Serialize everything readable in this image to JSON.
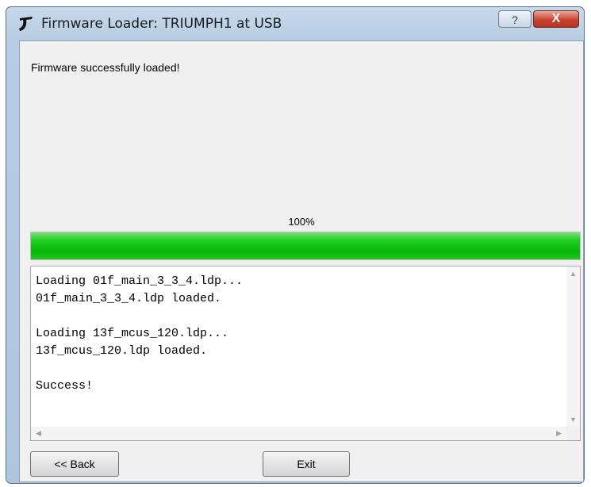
{
  "window": {
    "title": "Firmware Loader:  TRIUMPH1 at USB",
    "help_label": "?",
    "close_label": "X",
    "app_icon": "javad-logo-icon"
  },
  "status": {
    "message": "Firmware successfully loaded!"
  },
  "progress": {
    "percent_label": "100%",
    "value": 1.0,
    "color": "#0dc10d"
  },
  "log": {
    "text": "Loading 01f_main_3_3_4.ldp...\n01f_main_3_3_4.ldp loaded.\n\nLoading 13f_mcus_120.ldp...\n13f_mcus_120.ldp loaded.\n\nSuccess!"
  },
  "buttons": {
    "back_label": "<< Back",
    "exit_label": "Exit"
  }
}
